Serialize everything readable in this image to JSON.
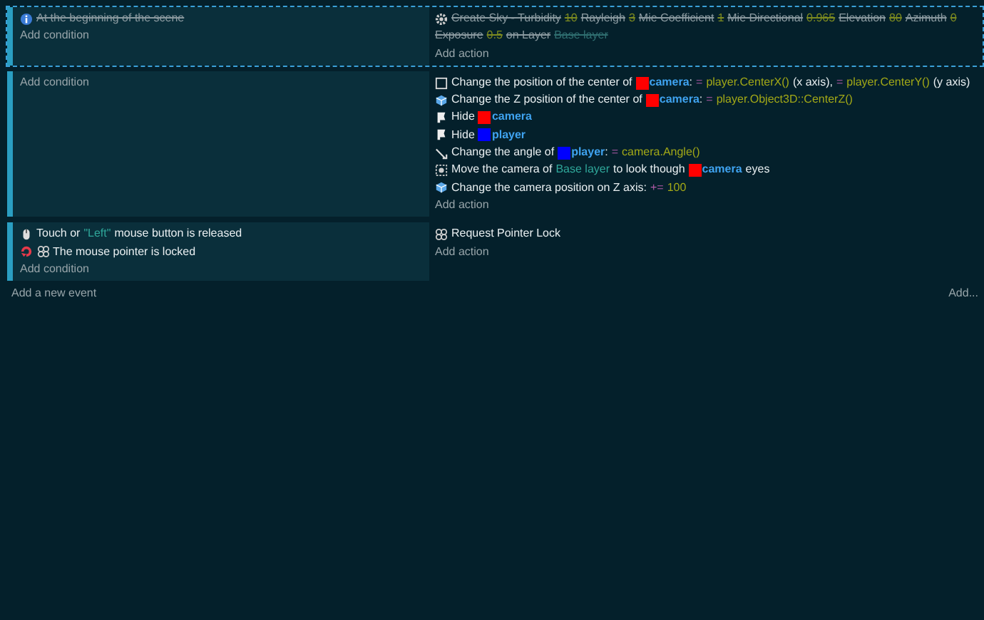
{
  "events": [
    {
      "disabled": true,
      "selected": true,
      "conditions": [
        {
          "kind": "start",
          "parts": [
            {
              "kind": "text",
              "text": "At the beginning of the scene"
            }
          ]
        }
      ],
      "add_condition": "Add condition",
      "actions": [
        {
          "kind": "sky",
          "parts": [
            {
              "kind": "text",
              "text": "Create Sky - Turbidity"
            },
            {
              "kind": "value",
              "text": "10"
            },
            {
              "kind": "text",
              "text": "Rayleigh"
            },
            {
              "kind": "value",
              "text": "3"
            },
            {
              "kind": "text",
              "text": "Mie Coefficient"
            },
            {
              "kind": "value",
              "text": "1"
            },
            {
              "kind": "text",
              "text": "Mie Directional"
            },
            {
              "kind": "value",
              "text": "0.965"
            },
            {
              "kind": "text",
              "text": "Elevation"
            },
            {
              "kind": "value",
              "text": "80"
            },
            {
              "kind": "text",
              "text": "Azimuth"
            },
            {
              "kind": "value",
              "text": "0"
            },
            {
              "kind": "text",
              "text": "Exposure"
            },
            {
              "kind": "value",
              "text": "0.5"
            },
            {
              "kind": "text",
              "text": "on Layer"
            },
            {
              "kind": "layer",
              "text": "Base layer"
            }
          ]
        }
      ],
      "add_action": "Add action"
    },
    {
      "disabled": false,
      "selected": false,
      "add_condition": "Add condition",
      "actions": [
        {
          "kind": "position",
          "parts": [
            {
              "kind": "text",
              "text": "Change the position of the center of"
            },
            {
              "kind": "object",
              "text": "camera",
              "color": "#ff0000"
            },
            {
              "kind": "punct",
              "text": ":"
            },
            {
              "kind": "operator",
              "text": "="
            },
            {
              "kind": "value",
              "text": "player.CenterX()"
            },
            {
              "kind": "text",
              "text": "(x axis),"
            },
            {
              "kind": "operator",
              "text": "="
            },
            {
              "kind": "value",
              "text": "player.CenterY()"
            },
            {
              "kind": "text",
              "text": "(y axis)"
            }
          ]
        },
        {
          "kind": "depth",
          "parts": [
            {
              "kind": "text",
              "text": "Change the Z position of the center of"
            },
            {
              "kind": "object",
              "text": "camera",
              "color": "#ff0000"
            },
            {
              "kind": "punct",
              "text": ":"
            },
            {
              "kind": "operator",
              "text": "="
            },
            {
              "kind": "value",
              "text": "player.Object3D::CenterZ()"
            }
          ]
        },
        {
          "kind": "visibility",
          "parts": [
            {
              "kind": "text",
              "text": "Hide"
            },
            {
              "kind": "object",
              "text": "camera",
              "color": "#ff0000"
            }
          ]
        },
        {
          "kind": "visibility",
          "parts": [
            {
              "kind": "text",
              "text": "Hide"
            },
            {
              "kind": "object",
              "text": "player",
              "color": "#0000ff"
            }
          ]
        },
        {
          "kind": "angle",
          "parts": [
            {
              "kind": "text",
              "text": "Change the angle of"
            },
            {
              "kind": "object",
              "text": "player",
              "color": "#0000ff"
            },
            {
              "kind": "punct",
              "text": ":"
            },
            {
              "kind": "operator",
              "text": "="
            },
            {
              "kind": "value",
              "text": "camera.Angle()"
            }
          ]
        },
        {
          "kind": "camera",
          "parts": [
            {
              "kind": "text",
              "text": "Move the camera of"
            },
            {
              "kind": "layer",
              "text": "Base layer"
            },
            {
              "kind": "text",
              "text": "to look though"
            },
            {
              "kind": "object",
              "text": "camera",
              "color": "#ff0000"
            },
            {
              "kind": "text",
              "text": "eyes"
            }
          ]
        },
        {
          "kind": "depth",
          "parts": [
            {
              "kind": "text",
              "text": "Change the camera position on Z axis:"
            },
            {
              "kind": "operator",
              "text": "+="
            },
            {
              "kind": "value",
              "text": "100"
            }
          ]
        }
      ],
      "add_action": "Add action"
    },
    {
      "disabled": false,
      "selected": false,
      "conditions": [
        {
          "kind": "mouse",
          "parts": [
            {
              "kind": "text",
              "text": "Touch or"
            },
            {
              "kind": "string",
              "text": "\"Left\""
            },
            {
              "kind": "text",
              "text": "mouse button is released"
            }
          ]
        },
        {
          "kind": "lock",
          "inverted": true,
          "parts": [
            {
              "kind": "text",
              "text": "The mouse pointer is locked"
            }
          ]
        }
      ],
      "add_condition": "Add condition",
      "actions": [
        {
          "kind": "lock",
          "parts": [
            {
              "kind": "text",
              "text": "Request Pointer Lock"
            }
          ]
        }
      ],
      "add_action": "Add action"
    }
  ],
  "add_event": "Add a new event",
  "add_menu": "Add..."
}
